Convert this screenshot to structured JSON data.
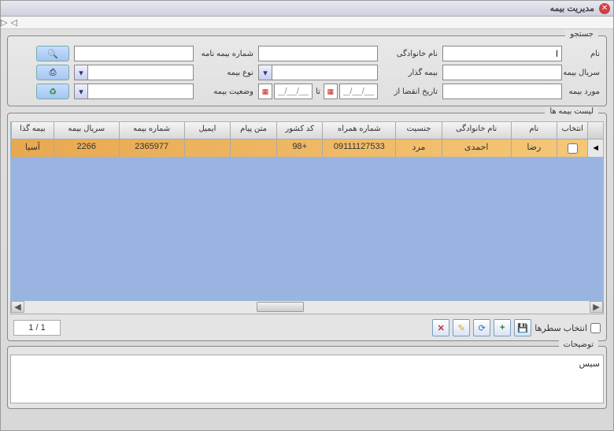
{
  "window": {
    "title": "مدیریت بیمه"
  },
  "search": {
    "legend": "جستجو",
    "labels": {
      "name": "نام",
      "family": "نام خانوادگی",
      "policyNo": "شماره بیمه نامه",
      "policySerial": "سریال بیمه نامه",
      "insurer": "بیمه گذار",
      "insType": "نوع بیمه",
      "insCase": "مورد بیمه",
      "expFrom": "تاریخ انقضا از",
      "to": "تا",
      "insStatus": "وضعیت بیمه"
    },
    "values": {
      "name": "ا",
      "family": "",
      "policyNo": "",
      "policySerial": "",
      "insurer": "",
      "insType": "",
      "insCase": "",
      "expFrom": "__/__/____",
      "expTo": "__/__/____",
      "insStatus": ""
    }
  },
  "list": {
    "legend": "لیست بیمه ها",
    "headers": {
      "select": "انتخاب",
      "name": "نام",
      "family": "نام خانوادگی",
      "gender": "جنسیت",
      "mobile": "شماره همراه",
      "countryCode": "کد کشور",
      "msgText": "متن پیام",
      "email": "ایمیل",
      "insNo": "شماره بیمه",
      "insSerial": "سریال بیمه",
      "insurer": "بیمه گذا"
    },
    "rows": [
      {
        "name": "رضا",
        "family": "احمدی",
        "gender": "مرد",
        "mobile": "09111127533",
        "countryCode": "+98",
        "msgText": "",
        "email": "",
        "insNo": "2365977",
        "insSerial": "2266",
        "insurer": "آسیا"
      }
    ],
    "footer": {
      "selectRows": "انتخاب سطرها",
      "pager": "1 / 1"
    }
  },
  "desc": {
    "legend": "توضیحات",
    "text": "سیس"
  },
  "icons": {
    "search": "🔍",
    "refresh": "♻",
    "clear": "✕",
    "print": "⎙",
    "add": "+",
    "sync": "⟳",
    "edit": "✎",
    "delete": "✕",
    "cal": "▦",
    "down": "▾",
    "arrow": "◄"
  }
}
